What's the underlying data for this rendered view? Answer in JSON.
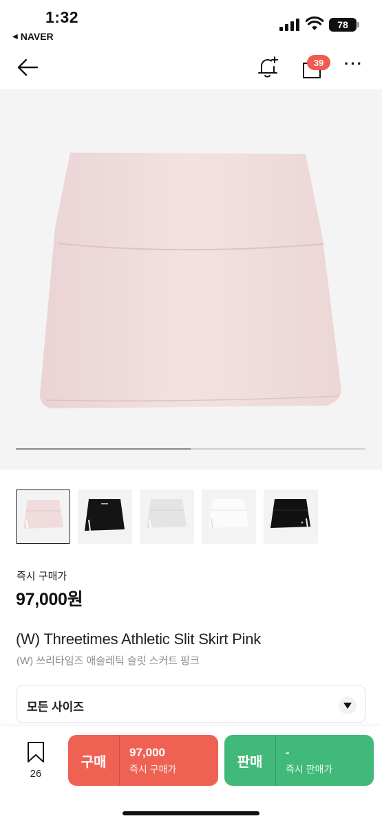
{
  "status_bar": {
    "time": "1:32",
    "back_app": "NAVER",
    "battery": "78"
  },
  "nav": {
    "notification_badge": "39"
  },
  "hero": {
    "image_progress": 0.5
  },
  "thumbnails": [
    {
      "color": "pink",
      "active": true
    },
    {
      "color": "black",
      "active": false
    },
    {
      "color": "light-gray",
      "active": false
    },
    {
      "color": "white",
      "active": false
    },
    {
      "color": "black",
      "active": false
    }
  ],
  "product": {
    "price_label": "즉시 구매가",
    "price": "97,000원",
    "title_en": "(W) Threetimes Athletic Slit Skirt Pink",
    "title_ko": "(W) 쓰리타임즈 애슬레틱 슬릿 스커트 핑크"
  },
  "size_selector": {
    "label": "모든 사이즈"
  },
  "bottom_bar": {
    "wish_count": "26",
    "buy": {
      "label": "구매",
      "price": "97,000",
      "sub": "즉시 구매가"
    },
    "sell": {
      "label": "판매",
      "price": "-",
      "sub": "즉시 판매가"
    }
  },
  "colors": {
    "buy": "#ef6253",
    "sell": "#41b979",
    "badge": "#ef5b4e",
    "skirt_pink": "#f0dcdc"
  }
}
